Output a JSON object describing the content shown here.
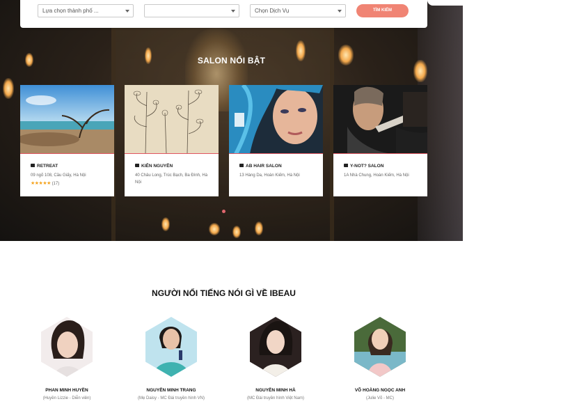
{
  "search": {
    "city_placeholder": "Lựa chọn thành phố ...",
    "district_placeholder": "",
    "service_placeholder": "Chọn Dịch Vụ",
    "button_label": "TÌM KIẾM"
  },
  "featured": {
    "title": "SALON NỔI BẬT",
    "salons": [
      {
        "name": "RETREAT",
        "address": "09 ngõ 108, Cầu Giấy, Hà Nội",
        "stars": "★★★★★",
        "reviews": "(17)"
      },
      {
        "name": "KIÊN NGUYỄN",
        "address": "40 Châu Long, Trúc Bạch, Ba Đình, Hà Nội"
      },
      {
        "name": "AB HAIR SALON",
        "address": "13 Hàng Da, Hoàn Kiếm, Hà Nội"
      },
      {
        "name": "Y-NOT? SALON",
        "address": "1A Nhà Chung, Hoàn Kiếm, Hà Nội"
      }
    ]
  },
  "celebrities": {
    "title": "NGƯỜI NỔI TIẾNG NÓI GÌ VỀ IBEAU",
    "people": [
      {
        "name": "PHAN MINH HUYỀN",
        "role": "(Huyền Lizzie - Diễn viên)"
      },
      {
        "name": "NGUYỄN MINH TRANG",
        "role": "(Mẹ Daisy - MC Đài truyền hình VN)"
      },
      {
        "name": "NGUYỄN MINH HÀ",
        "role": "(MC Đài truyền hình Việt Nam)"
      },
      {
        "name": "VÕ HOÀNG NGỌC ANH",
        "role": "(Julie Võ - MC)"
      }
    ]
  },
  "colors": {
    "accent": "#f08474",
    "star": "#f4a21c"
  }
}
